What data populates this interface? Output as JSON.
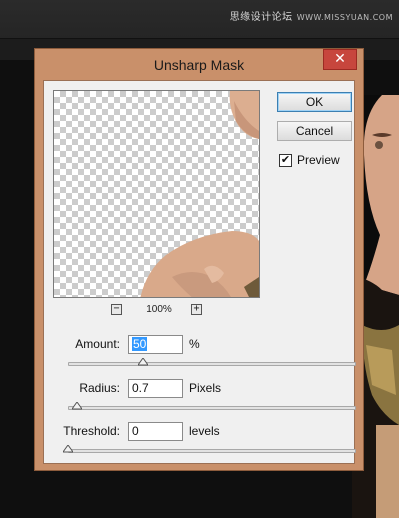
{
  "watermark": {
    "text": "思缘设计论坛",
    "url": "WWW.MISSYUAN.COM"
  },
  "dialog": {
    "title": "Unsharp Mask",
    "close_glyph": "✕",
    "ok_label": "OK",
    "cancel_label": "Cancel",
    "preview_label": "Preview",
    "preview_checked": true,
    "zoom": {
      "value": "100%",
      "minus": "−",
      "plus": "+"
    },
    "amount": {
      "label": "Amount:",
      "value": "50",
      "unit": "%",
      "slider_fraction": 0.26
    },
    "radius": {
      "label": "Radius:",
      "value": "0.7",
      "unit": "Pixels",
      "slider_fraction": 0.03
    },
    "threshold": {
      "label": "Threshold:",
      "value": "0",
      "unit": "levels",
      "slider_fraction": 0.0
    }
  },
  "colors": {
    "titlebar": "#c9906a",
    "close": "#c7463d",
    "selection": "#3399ff",
    "workspace": "#1c1c1c"
  }
}
